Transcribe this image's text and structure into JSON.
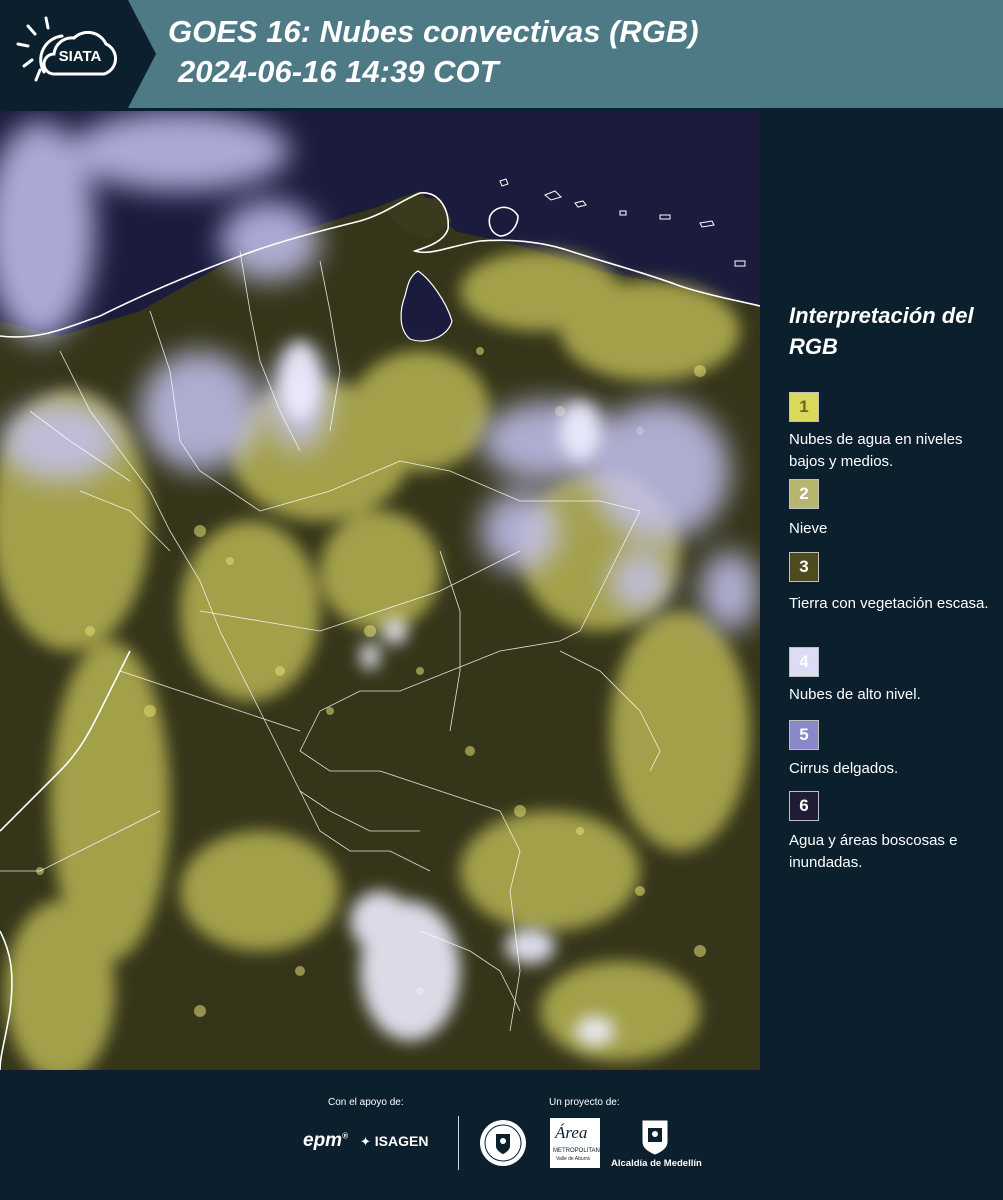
{
  "brand": {
    "logo_text": "SIATA"
  },
  "header": {
    "title_line1": "GOES 16: Nubes convectivas (RGB)",
    "title_line2": "2024-06-16 14:39 COT"
  },
  "legend": {
    "title": "Interpretación del RGB",
    "items": [
      {
        "number": "1",
        "label": "Nubes de agua en niveles bajos y medios.",
        "color": "#dbd95a",
        "number_color": "#6a6822"
      },
      {
        "number": "2",
        "label": "Nieve",
        "color": "#b7b56e",
        "number_color": "#ffffff"
      },
      {
        "number": "3",
        "label": "Tierra con vegetación escasa.",
        "color": "#4e4c1f",
        "number_color": "#ffffff"
      },
      {
        "number": "4",
        "label": "Nubes de alto nivel.",
        "color": "#dcdcf6",
        "number_color": "#ffffff"
      },
      {
        "number": "5",
        "label": "Cirrus delgados.",
        "color": "#8a88c8",
        "number_color": "#ffffff"
      },
      {
        "number": "6",
        "label": "Agua y áreas boscosas e inundadas.",
        "color": "#1f1d35",
        "number_color": "#ffffff"
      }
    ]
  },
  "footer": {
    "support_caption": "Con el apoyo de:",
    "project_caption": "Un proyecto de:",
    "sponsors": [
      "epm",
      "ISAGEN"
    ],
    "partners": [
      "Área Metropolitana Valle de Aburrá",
      "Alcaldía de Medellín"
    ],
    "partner_captions": [
      "METROPOLITANA",
      "Valle de Aburrá",
      "Alcaldía de Medellín"
    ]
  },
  "colors": {
    "header_bg": "#4e7a86",
    "panel_bg": "#0b1f2d",
    "map_ocean": "#1a1a3c",
    "map_land": "#3a3a1a",
    "low_cloud": "#d8d66a",
    "high_cloud": "#c8c6f0"
  }
}
